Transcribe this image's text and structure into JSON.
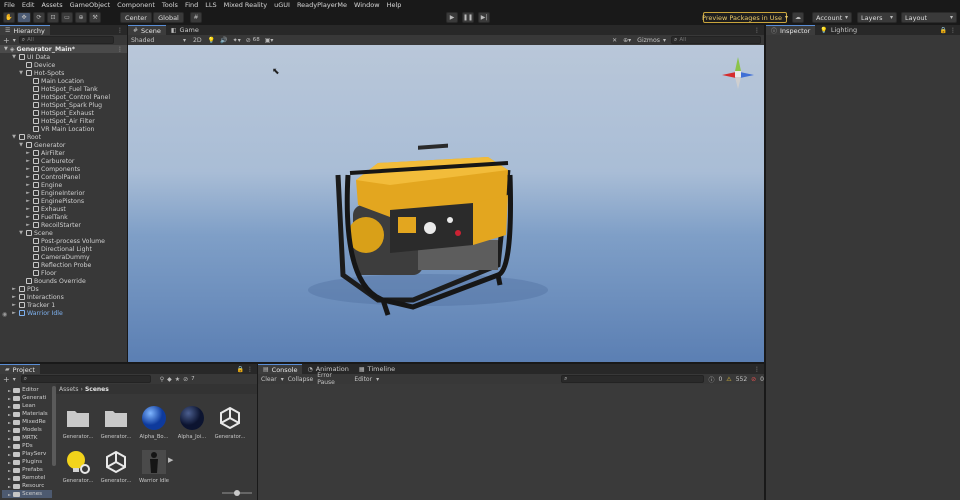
{
  "menu": [
    "File",
    "Edit",
    "Assets",
    "GameObject",
    "Component",
    "Tools",
    "Find",
    "LLS",
    "Mixed Reality",
    "uGUI",
    "ReadyPlayerMe",
    "Window",
    "Help"
  ],
  "toolbar": {
    "center_label": "Center",
    "global_label": "Global",
    "preview_packages": "Preview Packages in Use",
    "account": "Account",
    "layers": "Layers",
    "layout": "Layout"
  },
  "hierarchy": {
    "tab_label": "Hierarchy",
    "search_placeholder": "All",
    "scene_name": "Generator_Main*",
    "rows": [
      {
        "label": "UI Data",
        "indent": 1,
        "arrow": "▼"
      },
      {
        "label": "Device",
        "indent": 2,
        "arrow": ""
      },
      {
        "label": "Hot-Spots",
        "indent": 2,
        "arrow": "▼"
      },
      {
        "label": "Main Location",
        "indent": 3,
        "arrow": ""
      },
      {
        "label": "HotSpot_Fuel Tank",
        "indent": 3,
        "arrow": ""
      },
      {
        "label": "HotSpot_Control Panel",
        "indent": 3,
        "arrow": ""
      },
      {
        "label": "HotSpot_Spark Plug",
        "indent": 3,
        "arrow": ""
      },
      {
        "label": "HotSpot_Exhaust",
        "indent": 3,
        "arrow": ""
      },
      {
        "label": "HotSpot_Air Filter",
        "indent": 3,
        "arrow": ""
      },
      {
        "label": "VR Main Location",
        "indent": 3,
        "arrow": ""
      },
      {
        "label": "Root",
        "indent": 1,
        "arrow": "▼"
      },
      {
        "label": "Generator",
        "indent": 2,
        "arrow": "▼"
      },
      {
        "label": "AirFilter",
        "indent": 3,
        "arrow": "►"
      },
      {
        "label": "Carburetor",
        "indent": 3,
        "arrow": "►"
      },
      {
        "label": "Components",
        "indent": 3,
        "arrow": "►"
      },
      {
        "label": "ControlPanel",
        "indent": 3,
        "arrow": "►"
      },
      {
        "label": "Engine",
        "indent": 3,
        "arrow": "►"
      },
      {
        "label": "EngineInterior",
        "indent": 3,
        "arrow": "►"
      },
      {
        "label": "EnginePistons",
        "indent": 3,
        "arrow": "►"
      },
      {
        "label": "Exhaust",
        "indent": 3,
        "arrow": "►"
      },
      {
        "label": "FuelTank",
        "indent": 3,
        "arrow": "►"
      },
      {
        "label": "RecoilStarter",
        "indent": 3,
        "arrow": "►"
      },
      {
        "label": "Scene",
        "indent": 2,
        "arrow": "▼"
      },
      {
        "label": "Post-process Volume",
        "indent": 3,
        "arrow": ""
      },
      {
        "label": "Directional Light",
        "indent": 3,
        "arrow": ""
      },
      {
        "label": "CameraDummy",
        "indent": 3,
        "arrow": ""
      },
      {
        "label": "Reflection Probe",
        "indent": 3,
        "arrow": ""
      },
      {
        "label": "Floor",
        "indent": 3,
        "arrow": ""
      },
      {
        "label": "Bounds Override",
        "indent": 2,
        "arrow": ""
      },
      {
        "label": "PDs",
        "indent": 1,
        "arrow": "►"
      },
      {
        "label": "Interactions",
        "indent": 1,
        "arrow": "►"
      },
      {
        "label": "Tracker 1",
        "indent": 1,
        "arrow": "►"
      },
      {
        "label": "Warrior Idle",
        "indent": 1,
        "arrow": "►",
        "blue": true
      }
    ]
  },
  "scene_view": {
    "tabs": [
      {
        "label": "Scene",
        "active": true
      },
      {
        "label": "Game",
        "active": false
      }
    ],
    "shading": "Shaded",
    "mode_2d": "2D",
    "gizmos": "Gizmos",
    "search_placeholder": "All",
    "fx_count": "68"
  },
  "inspector": {
    "tabs": [
      {
        "label": "Inspector",
        "active": true
      },
      {
        "label": "Lighting",
        "active": false
      }
    ]
  },
  "project": {
    "tab_label": "Project",
    "breadcrumb": [
      "Assets",
      "Scenes"
    ],
    "count_badge": "7",
    "tree": [
      "Editor",
      "Generati",
      "Lean",
      "Materials",
      "MixedRe",
      "Models",
      "MRTK",
      "PDs",
      "PlayServ",
      "Plugins",
      "Prefabs",
      "Remotel",
      "Resourc",
      "Scenes"
    ],
    "assets": [
      {
        "label": "Generator...",
        "kind": "folder"
      },
      {
        "label": "Generator...",
        "kind": "folder"
      },
      {
        "label": "Alpha_Bo...",
        "kind": "sphere-blue"
      },
      {
        "label": "Alpha_Joi...",
        "kind": "sphere-dark"
      },
      {
        "label": "Generator...",
        "kind": "unity"
      },
      {
        "label": "Generator...",
        "kind": "light-settings"
      },
      {
        "label": "Generator...",
        "kind": "unity"
      },
      {
        "label": "Warrior Idle",
        "kind": "avatar"
      }
    ]
  },
  "console": {
    "tabs": [
      {
        "label": "Console",
        "active": true
      },
      {
        "label": "Animation",
        "active": false
      },
      {
        "label": "Timeline",
        "active": false
      }
    ],
    "buttons": [
      "Clear",
      "Collapse",
      "Error Pause",
      "Editor"
    ],
    "counts": {
      "info": "0",
      "warn": "552",
      "error": "0"
    }
  }
}
